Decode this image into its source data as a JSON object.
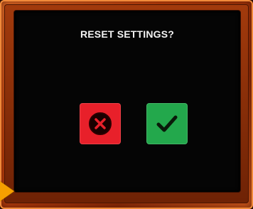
{
  "dialog": {
    "title": "RESET SETTINGS?",
    "cancel": {
      "icon": "x-close-icon",
      "color": "#e8202a"
    },
    "confirm": {
      "icon": "checkmark-icon",
      "color": "#23a84c"
    }
  },
  "theme": {
    "frame_color": "#c2410c",
    "screen_color": "#050505",
    "indicator_color": "#f5a000"
  }
}
